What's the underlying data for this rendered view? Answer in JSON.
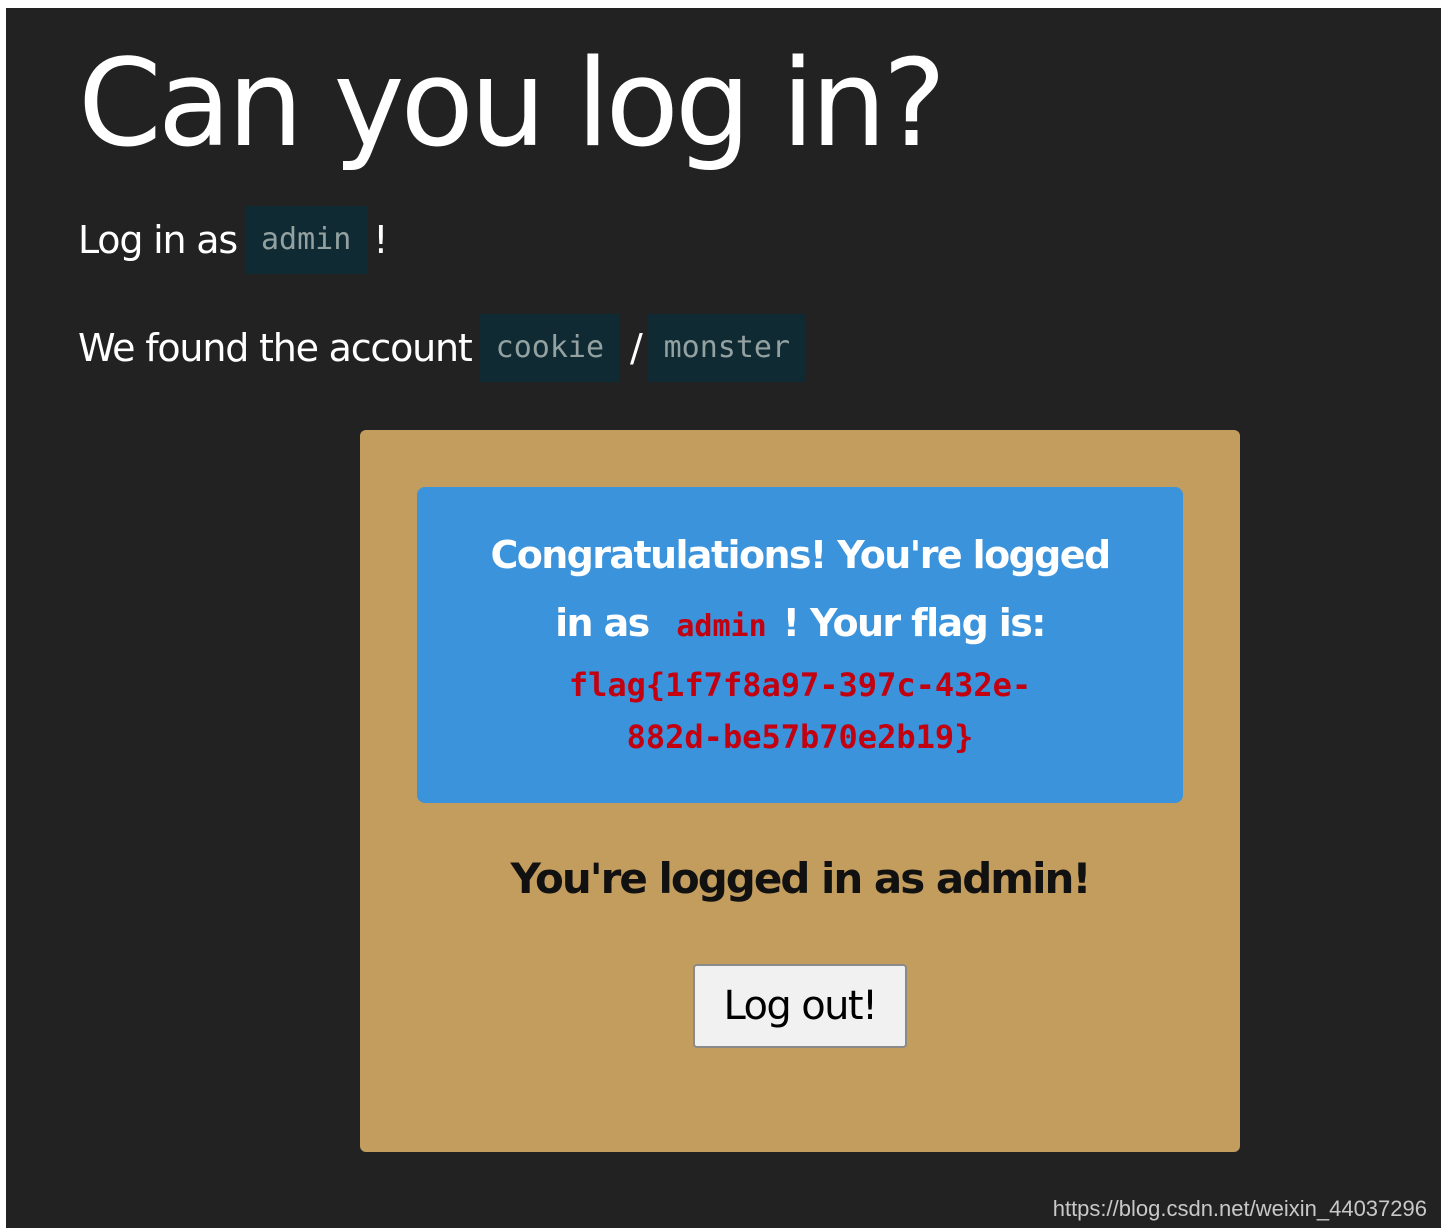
{
  "page": {
    "title": "Can you log in?"
  },
  "instructions": {
    "login_prefix": "Log in as",
    "login_user": "admin",
    "login_suffix": "!",
    "account_prefix": "We found the account",
    "account_user": "cookie",
    "account_separator": "/",
    "account_password": "monster"
  },
  "card": {
    "banner": {
      "line1": "Congratulations! You're logged",
      "line2_prefix": "in as",
      "line2_user": "admin",
      "line2_suffix": "! Your flag is:",
      "flag_line1": "flag{1f7f8a97-397c-432e-",
      "flag_line2": "882d-be57b70e2b19}"
    },
    "status_text": "You're logged in as admin!",
    "logout_label": "Log out!"
  },
  "watermark": "https://blog.csdn.net/weixin_44037296",
  "colors": {
    "page_background": "#222222",
    "card_background": "#c39d5d",
    "banner_background": "#3a93db",
    "code_background": "#0f2a33",
    "flag_text": "#c20010"
  }
}
